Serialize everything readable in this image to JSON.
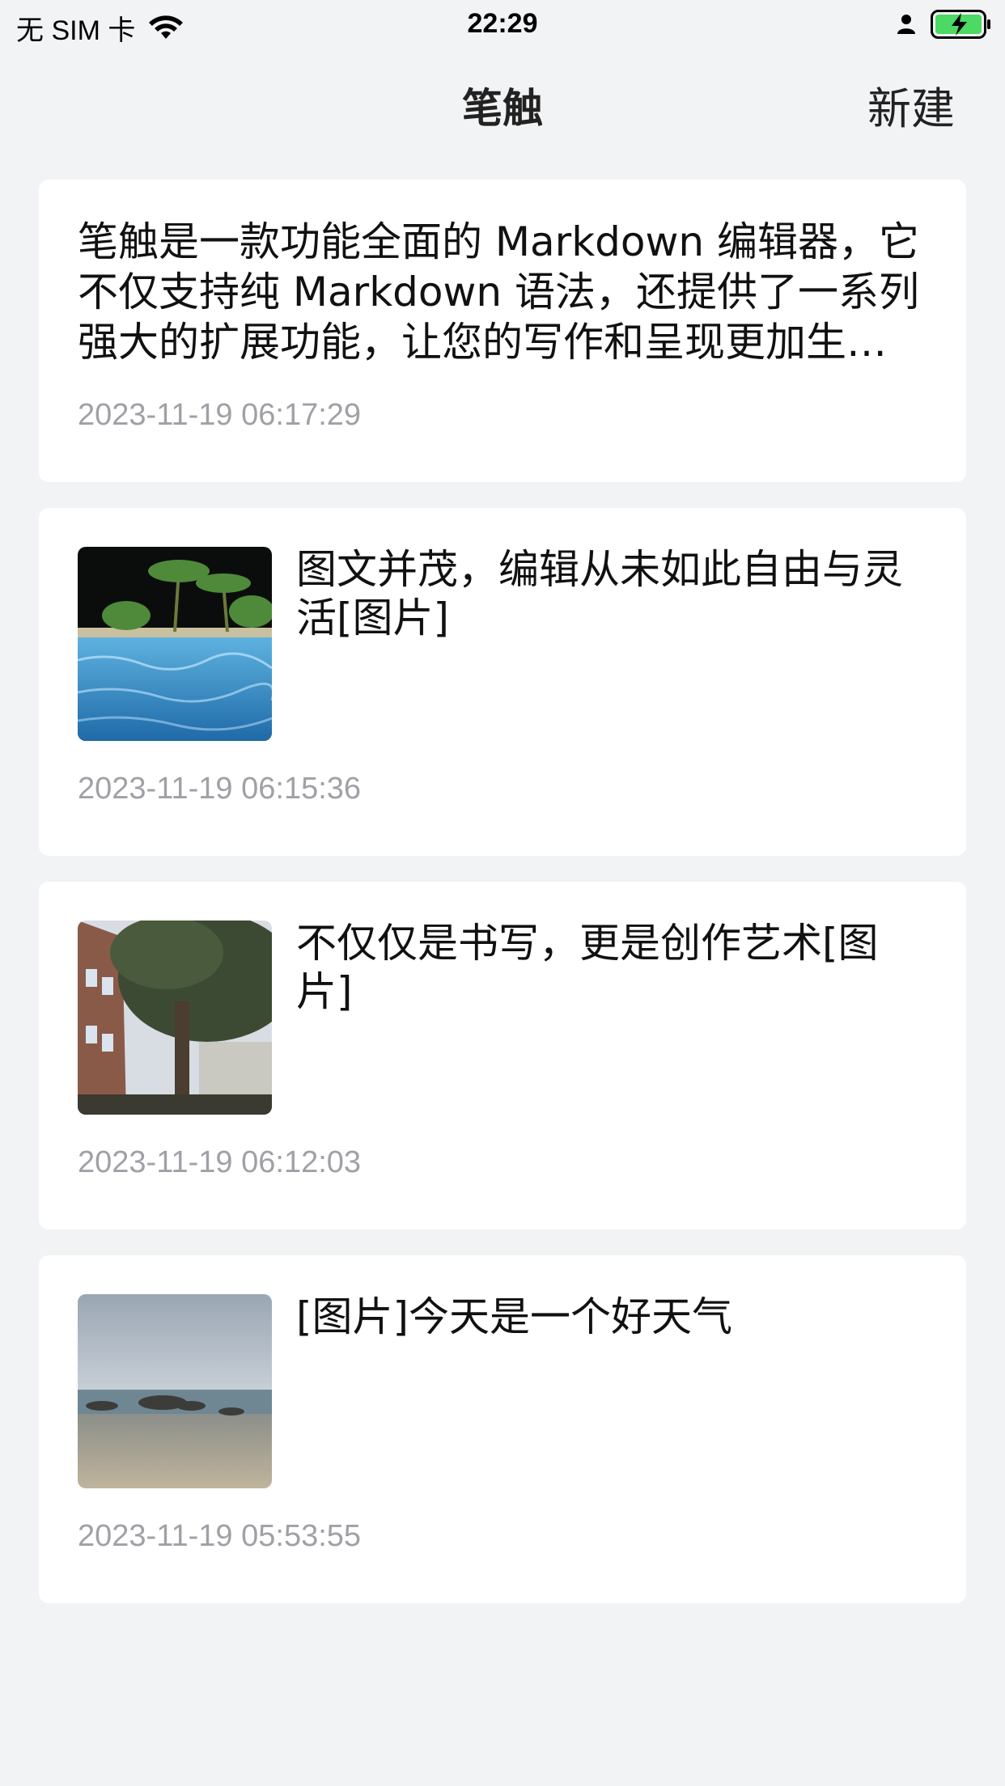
{
  "status_bar": {
    "carrier": "无 SIM 卡",
    "time": "22:29",
    "battery_color": "#4cd964"
  },
  "nav": {
    "title": "笔触",
    "new_label": "新建"
  },
  "notes": [
    {
      "text": "笔触是一款功能全面的 Markdown 编辑器，它不仅支持纯 Markdown 语法，还提供了一系列强大的扩展功能，让您的写作和呈现更加生…",
      "date": "2023-11-19 06:17:29"
    },
    {
      "text": "图文并茂，编辑从未如此自由与灵活[图片]",
      "date": "2023-11-19 06:15:36",
      "image": "night-pool-palm-trees"
    },
    {
      "text": "不仅仅是书写，更是创作艺术[图片]",
      "date": "2023-11-19 06:12:03",
      "image": "tree-and-buildings"
    },
    {
      "text": "[图片]今天是一个好天气",
      "date": "2023-11-19 05:53:55",
      "image": "beach-rocks-sea"
    }
  ]
}
